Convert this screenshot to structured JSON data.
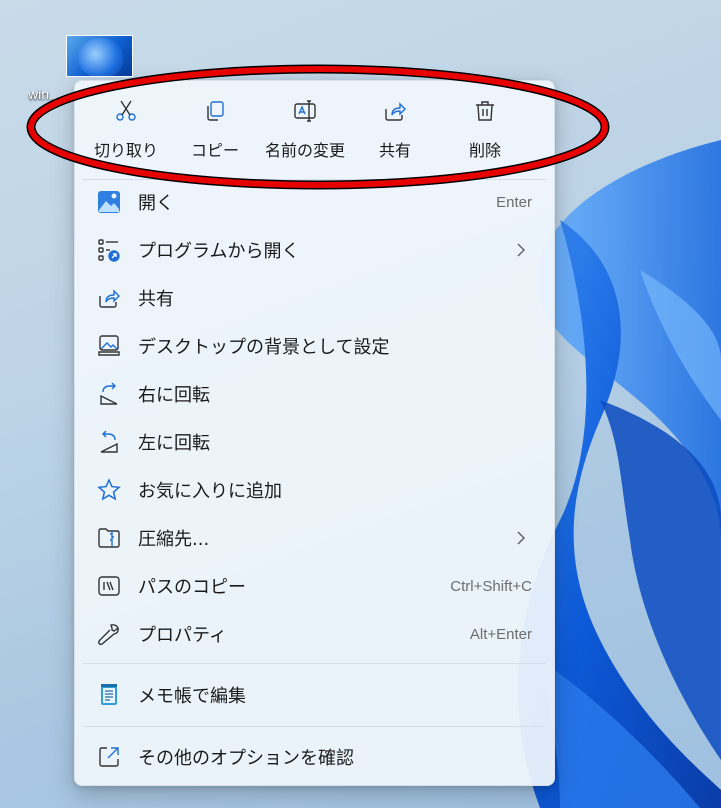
{
  "desktop": {
    "icon_label": "win..."
  },
  "quick_actions": [
    {
      "label": "切り取り",
      "icon": "scissors-icon"
    },
    {
      "label": "コピー",
      "icon": "copy-icon"
    },
    {
      "label": "名前の変更",
      "icon": "rename-icon"
    },
    {
      "label": "共有",
      "icon": "share-icon"
    },
    {
      "label": "削除",
      "icon": "trash-icon"
    }
  ],
  "menu_items": [
    {
      "label": "開く",
      "shortcut": "Enter",
      "icon": "photos-app-icon"
    },
    {
      "label": "プログラムから開く",
      "shortcut": "",
      "icon": "open-with-icon",
      "submenu": true
    },
    {
      "label": "共有",
      "shortcut": "",
      "icon": "share-icon"
    },
    {
      "label": "デスクトップの背景として設定",
      "shortcut": "",
      "icon": "wallpaper-icon"
    },
    {
      "label": "右に回転",
      "shortcut": "",
      "icon": "rotate-right-icon"
    },
    {
      "label": "左に回転",
      "shortcut": "",
      "icon": "rotate-left-icon"
    },
    {
      "label": "お気に入りに追加",
      "shortcut": "",
      "icon": "star-icon"
    },
    {
      "label": "圧縮先...",
      "shortcut": "",
      "icon": "zip-folder-icon",
      "submenu": true
    },
    {
      "label": "パスのコピー",
      "shortcut": "Ctrl+Shift+C",
      "icon": "copy-path-icon"
    },
    {
      "label": "プロパティ",
      "shortcut": "Alt+Enter",
      "icon": "wrench-icon"
    }
  ],
  "app_items": [
    {
      "label": "メモ帳で編集",
      "icon": "notepad-icon"
    }
  ],
  "footer_item": {
    "label": "その他のオプションを確認",
    "icon": "more-options-icon"
  },
  "colors": {
    "accent": "#1f6fd6",
    "annotation": "#e60000",
    "menu_bg": "#f0f6fc",
    "text": "#1a1a1a"
  }
}
